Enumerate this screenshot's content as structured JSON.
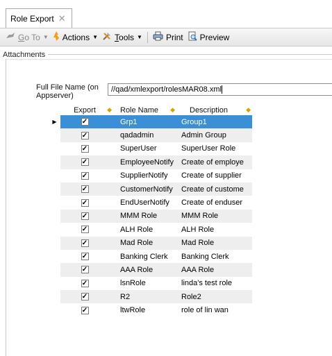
{
  "tab": {
    "title": "Role Export",
    "close_glyph": "✕"
  },
  "toolbar": {
    "goto_label": "Go To",
    "actions_label": "Actions",
    "tools_label": "Tools",
    "print_label": "Print",
    "preview_label": "Preview"
  },
  "section": {
    "attachments_label": "Attachments"
  },
  "form": {
    "file_label": "Full File Name (on Appserver)",
    "file_value": "//qad/xmlexport/rolesMAR08.xml"
  },
  "grid": {
    "columns": {
      "export": "Export",
      "role_name": "Role Name",
      "description": "Description"
    },
    "rows": [
      {
        "export": true,
        "name": "Grp1",
        "description": "Group1"
      },
      {
        "export": true,
        "name": "qadadmin",
        "description": "Admin Group"
      },
      {
        "export": true,
        "name": "SuperUser",
        "description": "SuperUser Role"
      },
      {
        "export": true,
        "name": "EmployeeNotify",
        "description": "Create of employe"
      },
      {
        "export": true,
        "name": "SupplierNotify",
        "description": "Create of supplier"
      },
      {
        "export": true,
        "name": "CustomerNotify",
        "description": "Create of custome"
      },
      {
        "export": true,
        "name": "EndUserNotify",
        "description": "Create of enduser"
      },
      {
        "export": true,
        "name": "MMM Role",
        "description": "MMM Role"
      },
      {
        "export": true,
        "name": "ALH Role",
        "description": "ALH Role"
      },
      {
        "export": true,
        "name": "Mad Role",
        "description": "Mad Role"
      },
      {
        "export": true,
        "name": "Banking Clerk",
        "description": "Banking Clerk"
      },
      {
        "export": true,
        "name": "AAA Role",
        "description": "AAA Role"
      },
      {
        "export": true,
        "name": "lsnRole",
        "description": "linda's test role"
      },
      {
        "export": true,
        "name": "R2",
        "description": "Role2"
      },
      {
        "export": true,
        "name": "ltwRole",
        "description": "role of lin wan"
      }
    ]
  },
  "colors": {
    "selection": "#3b8fd6",
    "alt_row": "#eeeeee",
    "sort_indicator": "#d5a400"
  }
}
